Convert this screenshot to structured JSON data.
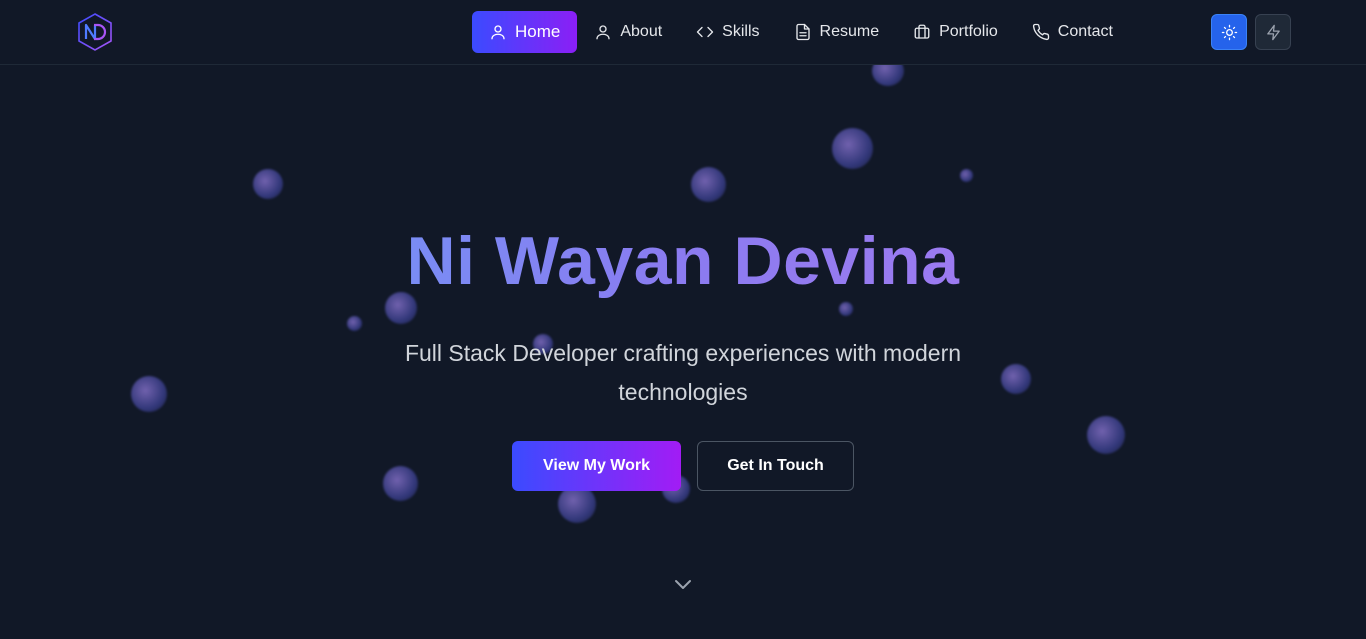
{
  "brand": {
    "logo_text": "ND",
    "logo_name": "nd-hexagon-logo"
  },
  "nav": {
    "items": [
      {
        "label": "Home",
        "icon": "user-icon",
        "active": true
      },
      {
        "label": "About",
        "icon": "user-icon",
        "active": false
      },
      {
        "label": "Skills",
        "icon": "code-icon",
        "active": false
      },
      {
        "label": "Resume",
        "icon": "document-icon",
        "active": false
      },
      {
        "label": "Portfolio",
        "icon": "briefcase-icon",
        "active": false
      },
      {
        "label": "Contact",
        "icon": "phone-icon",
        "active": false
      }
    ],
    "theme_toggle_icon": "sun-icon",
    "effects_toggle_icon": "bolt-icon"
  },
  "hero": {
    "title": "Ni Wayan Devina",
    "subtitle": "Full Stack Developer crafting experiences with modern technologies",
    "primary_cta": "View My Work",
    "secondary_cta": "Get In Touch",
    "scroll_icon": "chevron-down-icon"
  },
  "colors": {
    "background": "#111827",
    "accent_start": "#3b4bff",
    "accent_end": "#8b1ff5",
    "title_gradient_start": "#60a5fa",
    "title_gradient_end": "#b57af2",
    "theme_button": "#2563eb"
  }
}
